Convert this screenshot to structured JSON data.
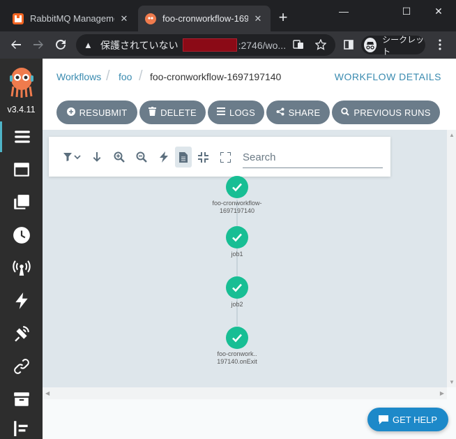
{
  "browser": {
    "tabs": [
      {
        "title": "RabbitMQ Manageme",
        "close": "✕"
      },
      {
        "title": "foo-cronworkflow-169",
        "close": "✕"
      }
    ],
    "new_tab": "+",
    "window_controls": {
      "minimize": "—",
      "maximize": "☐",
      "close": "✕"
    },
    "omnibox": {
      "security_text": "保護されていない",
      "url_suffix": ":2746/wo..."
    },
    "incognito_label": "シークレット"
  },
  "app": {
    "version": "v3.4.11",
    "breadcrumb": [
      "Workflows",
      "foo",
      "foo-cronworkflow-1697197140"
    ],
    "page_title": "WORKFLOW DETAILS",
    "actions": [
      {
        "label": "RESUBMIT",
        "icon": "plus-circle-icon"
      },
      {
        "label": "DELETE",
        "icon": "trash-icon"
      },
      {
        "label": "LOGS",
        "icon": "bars-icon"
      },
      {
        "label": "SHARE",
        "icon": "share-icon"
      },
      {
        "label": "PREVIOUS RUNS",
        "icon": "search-icon"
      }
    ],
    "graph_search_placeholder": "Search",
    "nodes": [
      {
        "label_line1": "foo-cronworkflow-",
        "label_line2": "1697197140",
        "status": "succeeded"
      },
      {
        "label_line1": "job1",
        "label_line2": "",
        "status": "succeeded"
      },
      {
        "label_line1": "job2",
        "label_line2": "",
        "status": "succeeded"
      },
      {
        "label_line1": "foo-cronwork..",
        "label_line2": "197140.onExit",
        "status": "succeeded"
      }
    ],
    "get_help": "GET HELP"
  },
  "colors": {
    "success": "#18be94",
    "accent": "#3a8bb0",
    "button": "#6b7c8a",
    "help": "#1d89c9"
  }
}
